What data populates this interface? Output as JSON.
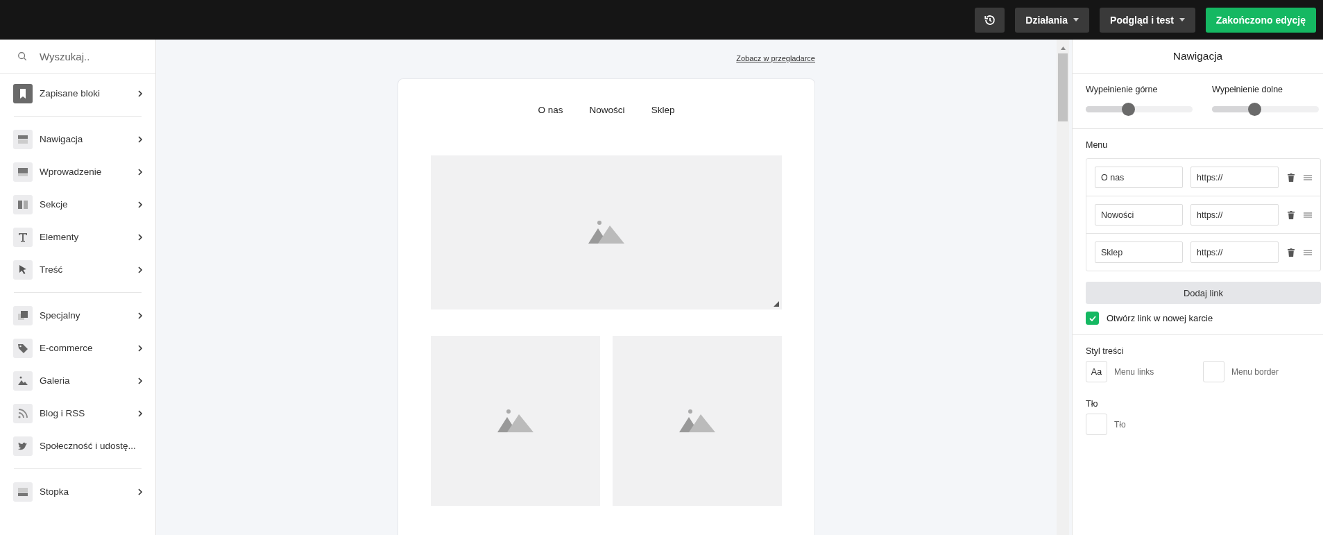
{
  "toolbar": {
    "history_button": true,
    "buttons": [
      {
        "label": "Działania",
        "kind": "dropdown"
      },
      {
        "label": "Podgląd i test",
        "kind": "dropdown"
      },
      {
        "label": "Zakończono edycję",
        "kind": "primary"
      }
    ]
  },
  "sidebar": {
    "search": {
      "placeholder": "Wyszukaj.."
    },
    "groups": [
      {
        "items": [
          {
            "label": "Zapisane bloki"
          }
        ]
      },
      {
        "items": [
          {
            "label": "Nawigacja"
          },
          {
            "label": "Wprowadzenie"
          },
          {
            "label": "Sekcje"
          },
          {
            "label": "Elementy"
          },
          {
            "label": "Treść"
          }
        ]
      },
      {
        "items": [
          {
            "label": "Specjalny"
          },
          {
            "label": "E-commerce"
          },
          {
            "label": "Galeria"
          },
          {
            "label": "Blog i RSS"
          },
          {
            "label": "Społeczność i udostę..."
          }
        ]
      },
      {
        "items": [
          {
            "label": "Stopka"
          }
        ]
      }
    ]
  },
  "canvas": {
    "browser_link": "Zobacz w przegladarce",
    "nav_links": [
      "O nas",
      "Nowości",
      "Sklep"
    ],
    "images": [
      {
        "kind": "picture"
      },
      {
        "kind": "picture"
      },
      {
        "kind": "picture"
      }
    ]
  },
  "panel": {
    "title": "Nawigacja",
    "sliders": [
      {
        "label": "Wypełnienie górne",
        "level": 0.4
      },
      {
        "label": "Wypełnienie dolne",
        "level": 0.4
      }
    ],
    "menu": {
      "heading": "Menu",
      "items": [
        {
          "label": "O nas",
          "url": "https://"
        },
        {
          "label": "Nowości",
          "url": "https://"
        },
        {
          "label": "Sklep",
          "url": "https://"
        }
      ],
      "add_button": "Dodaj link"
    },
    "new_tab": {
      "label": "Otwórz link w nowej karcie",
      "checked": true
    },
    "style": {
      "heading": "Styl treści",
      "options": [
        {
          "swatch": "Aa",
          "label": "Menu links"
        },
        {
          "label": "Menu border"
        }
      ]
    },
    "background": {
      "heading": "Tło",
      "options": [
        {
          "label": "Tło"
        }
      ]
    }
  }
}
